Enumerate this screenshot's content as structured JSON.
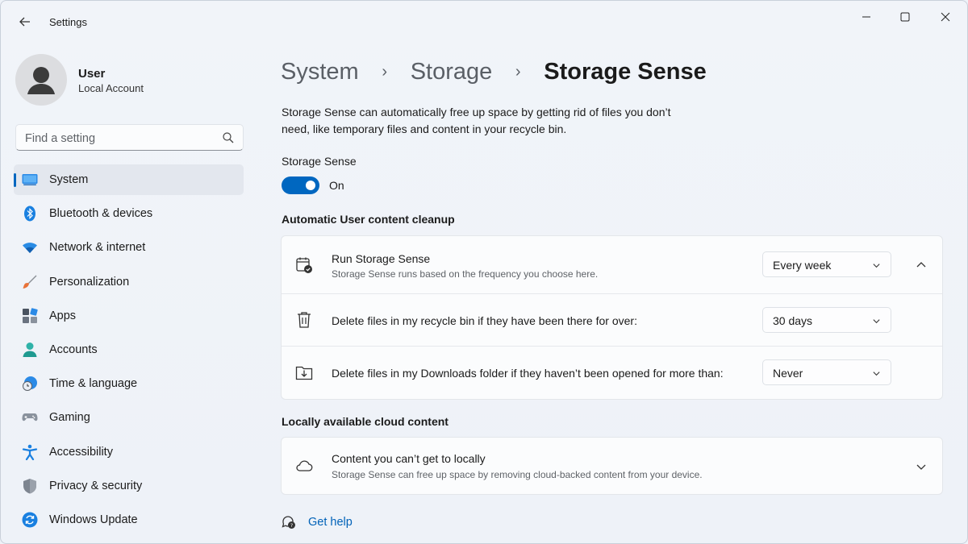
{
  "window": {
    "title": "Settings"
  },
  "profile": {
    "name": "User",
    "account_type": "Local Account"
  },
  "search": {
    "placeholder": "Find a setting"
  },
  "sidebar": {
    "items": [
      {
        "label": "System",
        "icon": "system-icon",
        "active": true
      },
      {
        "label": "Bluetooth & devices",
        "icon": "bluetooth-icon"
      },
      {
        "label": "Network & internet",
        "icon": "wifi-icon"
      },
      {
        "label": "Personalization",
        "icon": "brush-icon"
      },
      {
        "label": "Apps",
        "icon": "apps-icon"
      },
      {
        "label": "Accounts",
        "icon": "accounts-icon"
      },
      {
        "label": "Time & language",
        "icon": "time-language-icon"
      },
      {
        "label": "Gaming",
        "icon": "gamepad-icon"
      },
      {
        "label": "Accessibility",
        "icon": "accessibility-icon"
      },
      {
        "label": "Privacy & security",
        "icon": "shield-icon"
      },
      {
        "label": "Windows Update",
        "icon": "update-icon"
      }
    ]
  },
  "breadcrumb": {
    "items": [
      "System",
      "Storage",
      "Storage Sense"
    ]
  },
  "main": {
    "description": "Storage Sense can automatically free up space by getting rid of files you don’t need, like temporary files and content in your recycle bin.",
    "storage_sense_label": "Storage Sense",
    "toggle_state": "On",
    "section_cleanup": "Automatic User content cleanup",
    "cleanup_rows": [
      {
        "title": "Run Storage Sense",
        "subtitle": "Storage Sense runs based on the frequency you choose here.",
        "value": "Every week",
        "icon": "calendar-check-icon"
      },
      {
        "title": "Delete files in my recycle bin if they have been there for over:",
        "value": "30 days",
        "icon": "trash-icon"
      },
      {
        "title": "Delete files in my Downloads folder if they haven’t been opened for more than:",
        "value": "Never",
        "icon": "downloads-folder-icon"
      }
    ],
    "section_cloud": "Locally available cloud content",
    "cloud_row": {
      "title": "Content you can’t get to locally",
      "subtitle": "Storage Sense can free up space by removing cloud-backed content from your device.",
      "icon": "cloud-icon"
    },
    "help_link": "Get help"
  },
  "colors": {
    "accent": "#0067c0",
    "link": "#0062b8",
    "background": "#eef2f8"
  }
}
